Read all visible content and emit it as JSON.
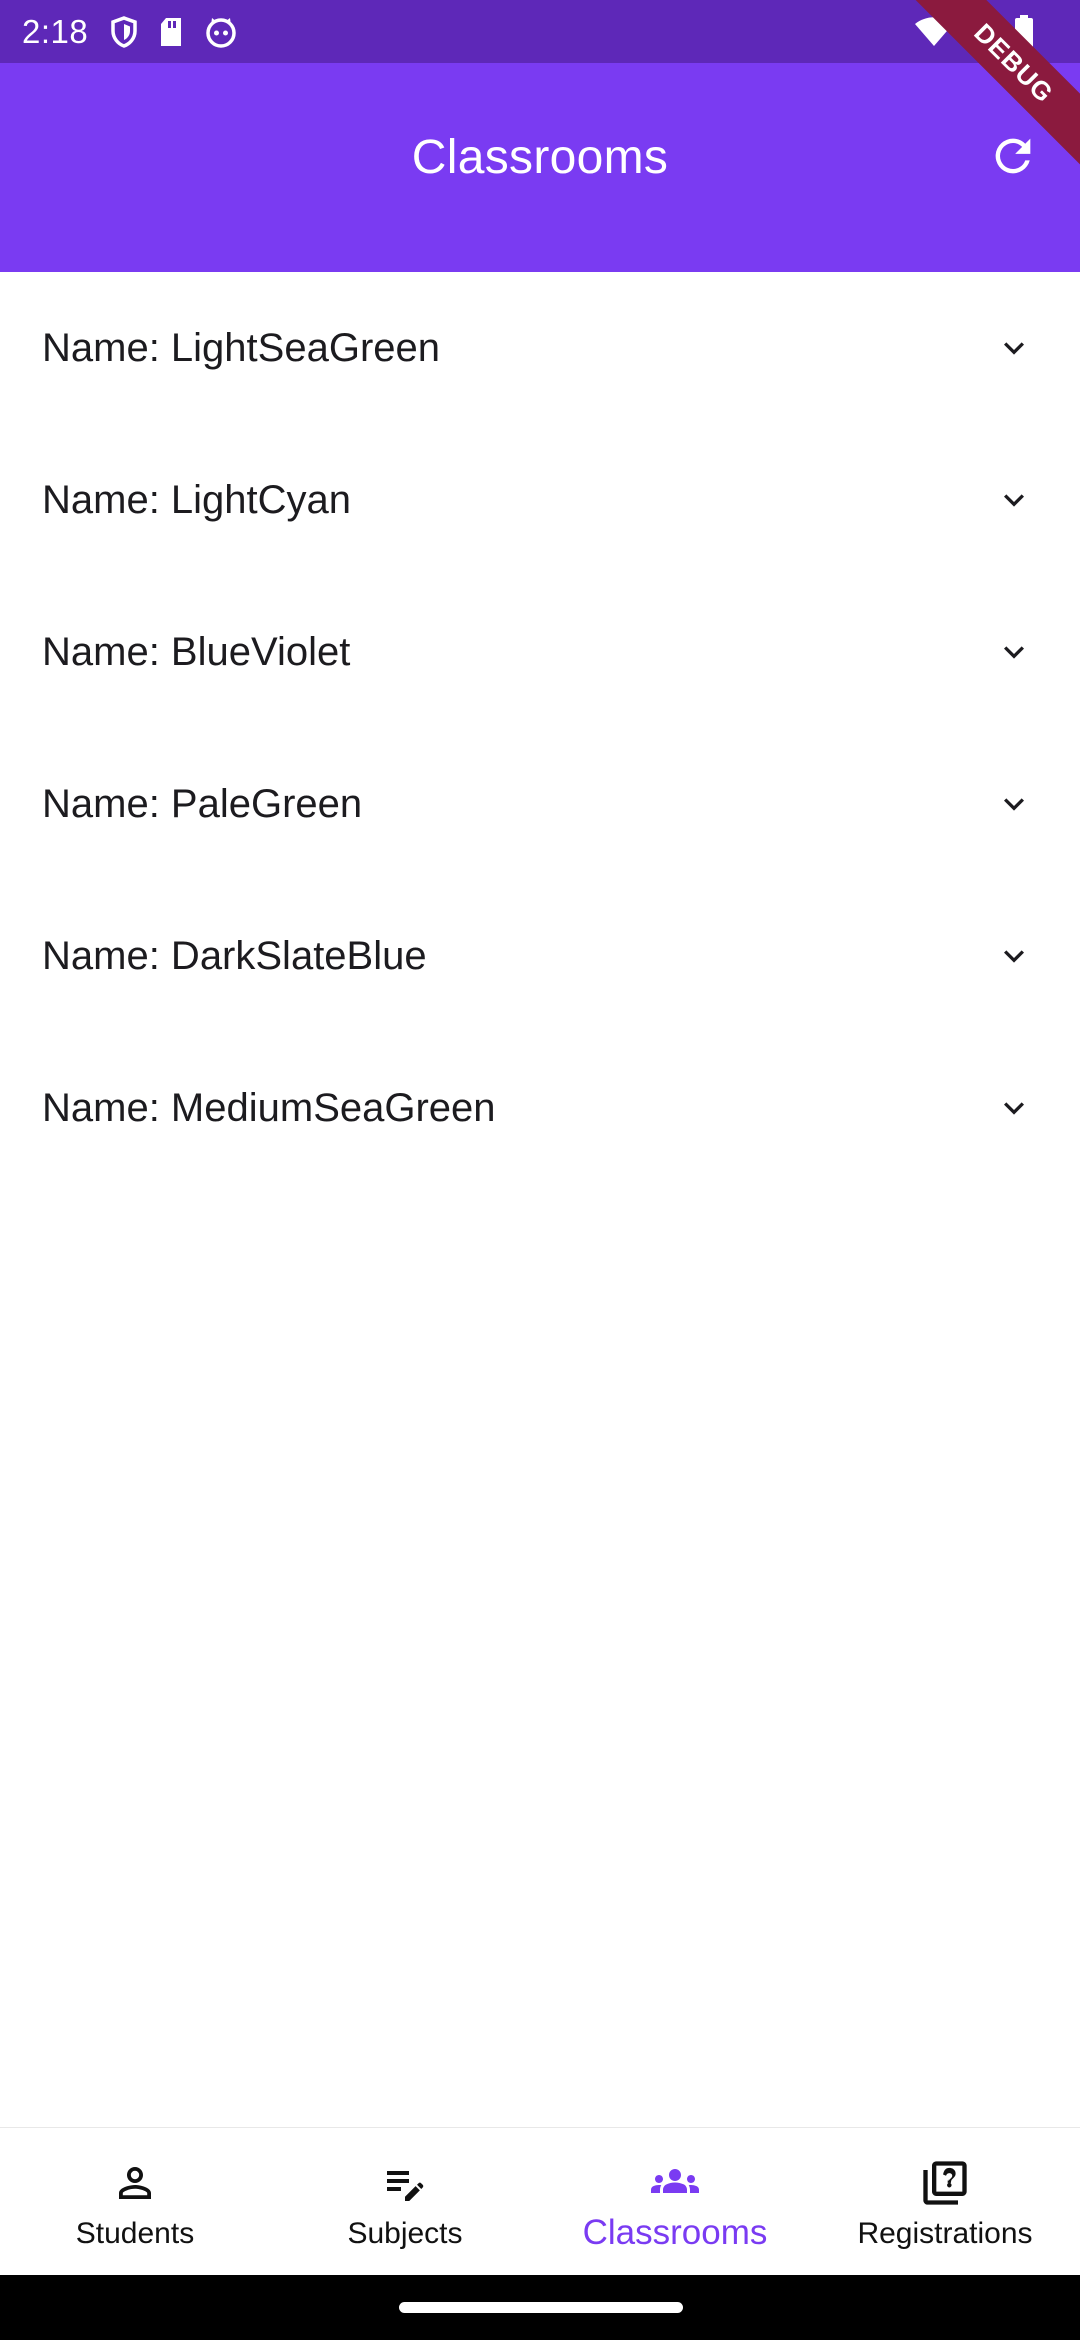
{
  "status_bar": {
    "time": "2:18",
    "left_icons": [
      "shield-icon",
      "sd-card-icon",
      "cat-icon"
    ],
    "right_icons": [
      "wifi-icon",
      "signal-icon",
      "battery-icon"
    ]
  },
  "app_bar": {
    "title": "Classrooms",
    "refresh_icon": "refresh-icon",
    "color": "#7a3bf2"
  },
  "debug_banner": "DEBUG",
  "classrooms": [
    {
      "label": "Name: LightSeaGreen"
    },
    {
      "label": "Name: LightCyan"
    },
    {
      "label": "Name: BlueViolet"
    },
    {
      "label": "Name: PaleGreen"
    },
    {
      "label": "Name: DarkSlateBlue"
    },
    {
      "label": "Name: MediumSeaGreen"
    }
  ],
  "bottom_nav": {
    "items": [
      {
        "label": "Students",
        "icon": "person-icon",
        "active": false
      },
      {
        "label": "Subjects",
        "icon": "edit-list-icon",
        "active": false
      },
      {
        "label": "Classrooms",
        "icon": "groups-icon",
        "active": true
      },
      {
        "label": "Registrations",
        "icon": "quiz-icon",
        "active": false
      }
    ],
    "active_color": "#7a3bf2"
  }
}
